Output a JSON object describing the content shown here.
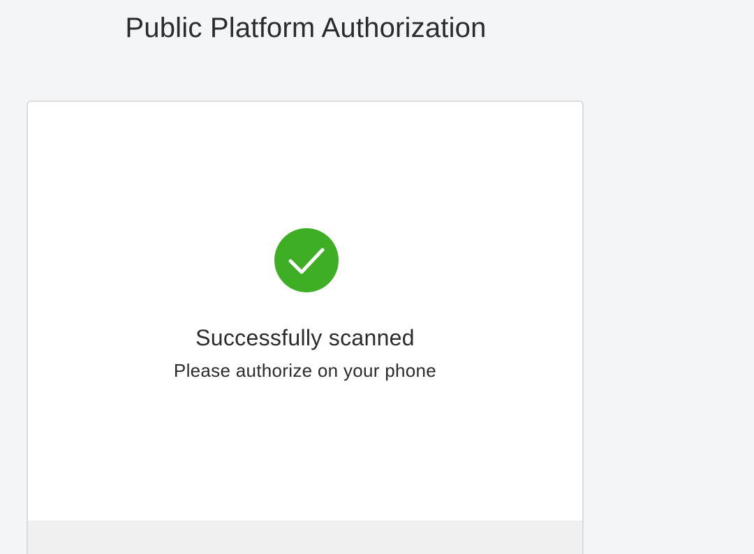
{
  "page": {
    "title": "Public Platform Authorization"
  },
  "status": {
    "icon": "check-circle-icon",
    "title": "Successfully scanned",
    "subtitle": "Please authorize on your phone"
  },
  "colors": {
    "success": "#3eaf24",
    "background": "#f4f5f7",
    "card": "#ffffff",
    "footer": "#f0f0f0"
  }
}
